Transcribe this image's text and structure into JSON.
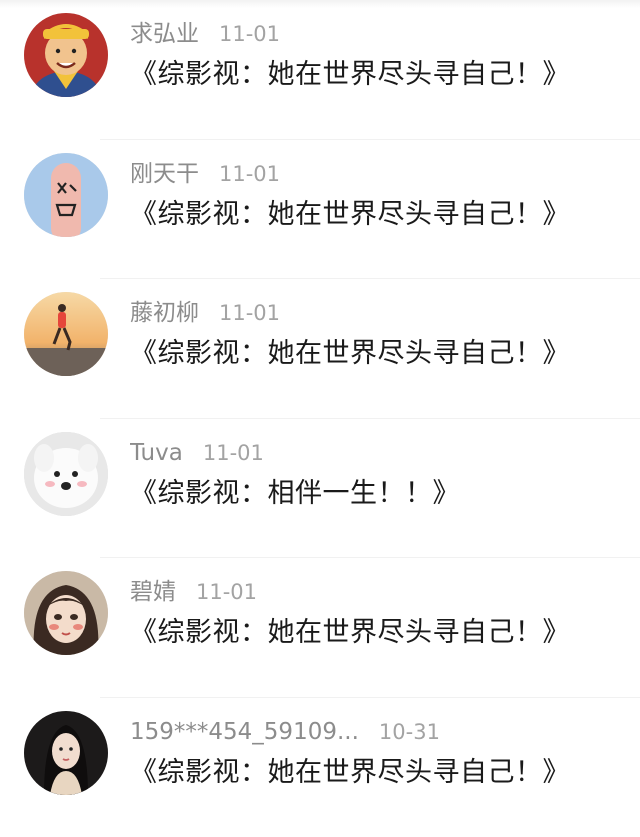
{
  "comments": [
    {
      "avatar_icon": "cartoon-man-avatar-icon",
      "username": "求弘业",
      "time": "11-01",
      "text": "《综影视：她在世界尽头寻自己！》"
    },
    {
      "avatar_icon": "finger-face-avatar-icon",
      "username": "刚天干",
      "time": "11-01",
      "text": "《综影视：她在世界尽头寻自己！》"
    },
    {
      "avatar_icon": "runner-avatar-icon",
      "username": "藤初柳",
      "time": "11-01",
      "text": "《综影视：她在世界尽头寻自己！》"
    },
    {
      "avatar_icon": "white-dog-avatar-icon",
      "username": "Tuva",
      "time": "11-01",
      "text": "《综影视：相伴一生！！》"
    },
    {
      "avatar_icon": "girl-illustration-avatar-icon",
      "username": "碧婧",
      "time": "11-01",
      "text": "《综影视：她在世界尽头寻自己！》"
    },
    {
      "avatar_icon": "woman-portrait-avatar-icon",
      "username": "159***454_59109...",
      "time": "10-31",
      "text": "《综影视：她在世界尽头寻自己！》"
    }
  ]
}
